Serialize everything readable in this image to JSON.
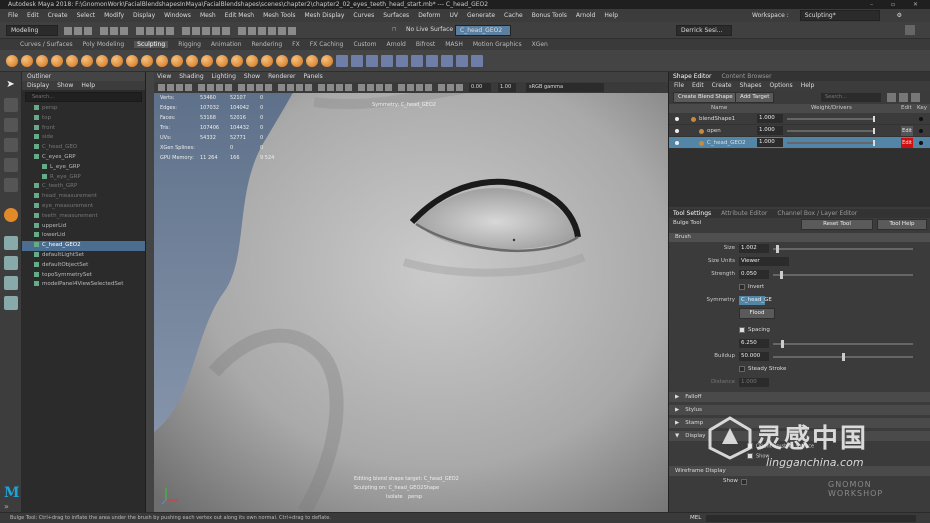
{
  "title": "Autodesk Maya 2018: F:\\GnomonWork\\FacialBlendshapesInMaya\\FacialBlendshapes\\scenes\\chapter2\\chapter2_02_eyes_teeth_head_start.mb*  ---  C_head_GEO2",
  "menu": [
    "File",
    "Edit",
    "Create",
    "Select",
    "Modify",
    "Display",
    "Windows",
    "Mesh",
    "Edit Mesh",
    "Mesh Tools",
    "Mesh Display",
    "Curves",
    "Surfaces",
    "Deform",
    "UV",
    "Generate",
    "Cache",
    "Bonus Tools",
    "Arnold",
    "Help"
  ],
  "workspace": {
    "label": "Workspace :",
    "value": "Sculpting*"
  },
  "status": {
    "mode": "Modeling",
    "live": "No Live Surface",
    "object": "C_head_GEO2",
    "user": "Derrick Sesi..."
  },
  "shelf_tabs": [
    "Curves / Surfaces",
    "Poly Modeling",
    "Sculpting",
    "Rigging",
    "Animation",
    "Rendering",
    "FX",
    "FX Caching",
    "Custom",
    "Arnold",
    "Bifrost",
    "MASH",
    "Motion Graphics",
    "XGen"
  ],
  "shelf_active": "Sculpting",
  "outliner": {
    "title": "Outliner",
    "menu": [
      "Display",
      "Show",
      "Help"
    ],
    "search": "Search...",
    "items": [
      {
        "label": "persp",
        "dim": true,
        "indent": 0
      },
      {
        "label": "top",
        "dim": true,
        "indent": 0
      },
      {
        "label": "front",
        "dim": true,
        "indent": 0
      },
      {
        "label": "side",
        "dim": true,
        "indent": 0
      },
      {
        "label": "C_head_GEO",
        "dim": true,
        "indent": 0
      },
      {
        "label": "C_eyes_GRP",
        "dim": false,
        "indent": 0
      },
      {
        "label": "L_eye_GRP",
        "dim": false,
        "indent": 1
      },
      {
        "label": "R_eye_GRP",
        "dim": true,
        "indent": 1
      },
      {
        "label": "C_teeth_GRP",
        "dim": true,
        "indent": 0
      },
      {
        "label": "head_measurement",
        "dim": true,
        "indent": 0
      },
      {
        "label": "eye_measurement",
        "dim": true,
        "indent": 0
      },
      {
        "label": "teeth_measurement",
        "dim": true,
        "indent": 0
      },
      {
        "label": "upperLid",
        "dim": false,
        "indent": 0
      },
      {
        "label": "lowerLid",
        "dim": false,
        "indent": 0
      },
      {
        "label": "C_head_GEO2",
        "dim": false,
        "indent": 0,
        "selected": true
      },
      {
        "label": "defaultLightSet",
        "dim": false,
        "indent": 0
      },
      {
        "label": "defaultObjectSet",
        "dim": false,
        "indent": 0
      },
      {
        "label": "topoSymmetrySet",
        "dim": false,
        "indent": 0
      },
      {
        "label": "modelPanel4ViewSelectedSet",
        "dim": false,
        "indent": 0
      }
    ]
  },
  "viewport": {
    "menu": [
      "View",
      "Shading",
      "Lighting",
      "Show",
      "Renderer",
      "Panels"
    ],
    "exposure": "0.00",
    "gamma": "1.00",
    "colorspace": "sRGB gamma",
    "hud": {
      "rows": [
        {
          "label": "Verts:",
          "a": "53460",
          "b": "52107",
          "c": "0"
        },
        {
          "label": "Edges:",
          "a": "107032",
          "b": "104042",
          "c": "0"
        },
        {
          "label": "Faces:",
          "a": "53168",
          "b": "52016",
          "c": "0"
        },
        {
          "label": "Tris:",
          "a": "107406",
          "b": "104432",
          "c": "0"
        },
        {
          "label": "UVs:",
          "a": "54332",
          "b": "52771",
          "c": "0"
        },
        {
          "label": "XGen Splines:",
          "a": "",
          "b": "0",
          "c": "0"
        },
        {
          "label": "GPU Memory:",
          "a": "11 264",
          "b": "166",
          "c": "9 524"
        }
      ],
      "symmetry": "Symmetry:  C_head_GEO2",
      "editing": "Editing blend shape target:  C_head_GEO2",
      "sculpting": "Sculpting on:  C_head_GEO2Shape",
      "isolate": "Isolate",
      "persp": "persp"
    }
  },
  "shape_editor": {
    "tabs": [
      "Shape Editor",
      "Content Browser"
    ],
    "menu": [
      "File",
      "Edit",
      "Create",
      "Shapes",
      "Options",
      "Help"
    ],
    "create_btn": "Create Blend Shape",
    "add_btn": "Add Target",
    "search": "Search...",
    "headers": {
      "name": "Name",
      "weight": "Weight/Drivers",
      "edit": "Edit",
      "key": "Key"
    },
    "rows": [
      {
        "name": "blendShape1",
        "weight": "1.000",
        "indent": 1,
        "edit": "",
        "red": false,
        "selected": false
      },
      {
        "name": "open",
        "weight": "1.000",
        "indent": 2,
        "edit": "Edit",
        "red": false,
        "selected": false
      },
      {
        "name": "C_head_GEO2",
        "weight": "1.000",
        "indent": 2,
        "edit": "Edit",
        "red": true,
        "selected": true
      }
    ]
  },
  "tool_settings": {
    "tabs": [
      "Tool Settings",
      "Attribute Editor",
      "Channel Box / Layer Editor"
    ],
    "tool_name": "Bulge Tool",
    "reset": "Reset Tool",
    "help": "Tool Help",
    "brush_header": "Brush",
    "size_label": "Size",
    "size_value": "1.002",
    "size_frac": 0.02,
    "size_units_label": "Size Units",
    "size_units": "Viewer",
    "strength_label": "Strength",
    "strength_value": "0.050",
    "strength_frac": 0.05,
    "invert": "Invert",
    "symmetry_label": "Symmetry",
    "symmetry_value": "C_head_GE",
    "flood": "Flood",
    "spacing": "Spacing",
    "spacing_value": "6.250",
    "spacing_frac": 0.06,
    "buildup_label": "Buildup",
    "buildup_value": "50.000",
    "buildup_frac": 0.5,
    "steady": "Steady Stroke",
    "distance_label": "Distance",
    "distance_value": "1.000",
    "sections": [
      "Falloff",
      "Stylus",
      "Stamp",
      "Display"
    ],
    "display_items": [
      "Orient brush to surface",
      "Show"
    ],
    "wireframe": "Wireframe Display",
    "show": "Show"
  },
  "watermark": {
    "text": "灵感中国",
    "url": "lingganchina.com",
    "brand": "GNOMON WORKSHOP"
  },
  "helpline": "Bulge Tool: Ctrl+drag to inflate the area under the brush by pushing each vertex out along its own normal. Ctrl+drag to deflate.",
  "mel": "MEL"
}
